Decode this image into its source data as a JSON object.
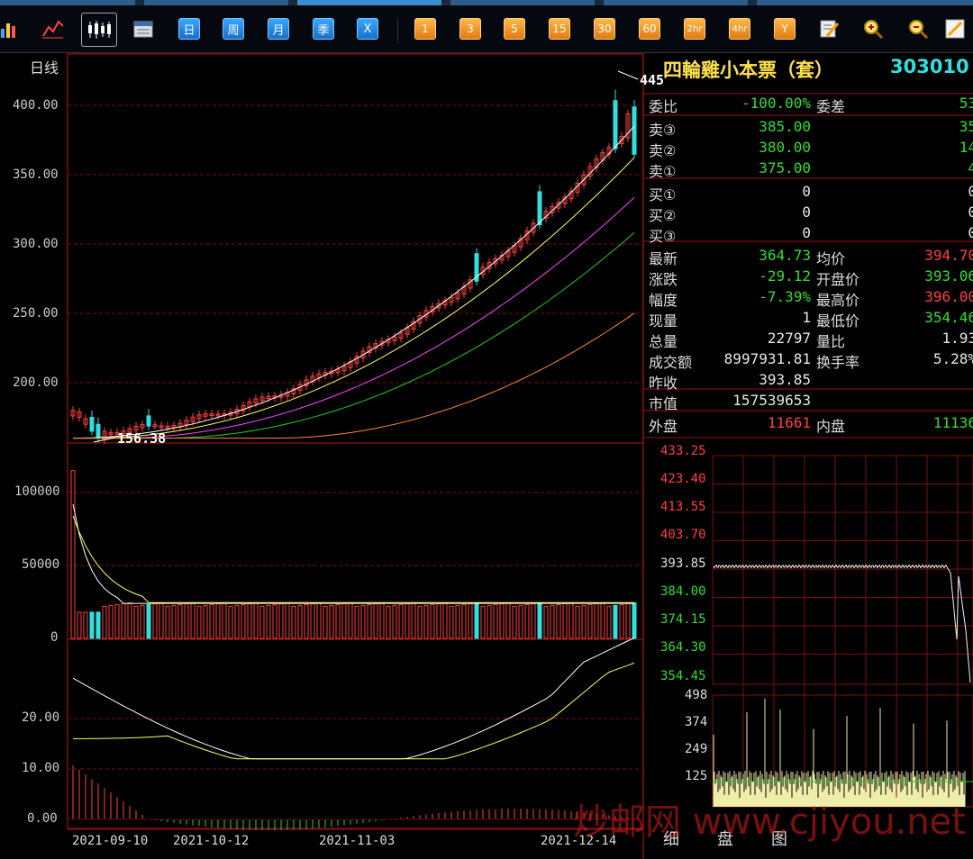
{
  "toolbar": {
    "period_buttons": [
      "日",
      "周",
      "月",
      "季",
      "X"
    ],
    "minute_buttons": [
      "1",
      "3",
      "5",
      "15",
      "30",
      "60",
      "2hr",
      "4hr",
      "Y"
    ],
    "icons": [
      "bar-chart-icon",
      "line-chart-icon",
      "candlestick-icon",
      "calendar-icon",
      "edit-icon",
      "zoom-in-icon",
      "zoom-out-icon",
      "draw-pencil-icon"
    ]
  },
  "main_chart": {
    "period_label": "日线",
    "y_ticks": [
      "400.00",
      "350.00",
      "300.00",
      "250.00",
      "200.00"
    ],
    "high_marker": "445",
    "low_marker": "156.38"
  },
  "volume_chart": {
    "y_ticks": [
      "100000",
      "50000",
      "0"
    ]
  },
  "indicator_chart": {
    "y_ticks": [
      "20.00",
      "10.00",
      "0.00"
    ]
  },
  "x_axis_dates": [
    "2021-09-10",
    "2021-10-12",
    "2021-11-03",
    "2021-12-14"
  ],
  "quote": {
    "title": "四輪雞小本票（套）",
    "code": "303010",
    "weibi_label": "委比",
    "weibi_value": "-100.00%",
    "weicha_label": "委差",
    "weicha_value": "53",
    "asks": [
      {
        "label": "卖③",
        "price": "385.00",
        "vol": "35"
      },
      {
        "label": "卖②",
        "price": "380.00",
        "vol": "14"
      },
      {
        "label": "卖①",
        "price": "375.00",
        "vol": "4"
      }
    ],
    "bids": [
      {
        "label": "买①",
        "price": "0",
        "vol": "0"
      },
      {
        "label": "买②",
        "price": "0",
        "vol": "0"
      },
      {
        "label": "买③",
        "price": "0",
        "vol": "0"
      }
    ],
    "stats_left": [
      {
        "label": "最新",
        "value": "364.73"
      },
      {
        "label": "涨跌",
        "value": "-29.12"
      },
      {
        "label": "幅度",
        "value": "-7.39%"
      },
      {
        "label": "现量",
        "value": "1"
      },
      {
        "label": "总量",
        "value": "22797"
      },
      {
        "label": "成交额",
        "value": "8997931.81"
      },
      {
        "label": "昨收",
        "value": "393.85"
      },
      {
        "label": "市值",
        "value": "157539653"
      }
    ],
    "stats_right": [
      {
        "label": "均价",
        "value": "394.70"
      },
      {
        "label": "开盘价",
        "value": "393.06"
      },
      {
        "label": "最高价",
        "value": "396.00"
      },
      {
        "label": "最低价",
        "value": "354.46"
      },
      {
        "label": "量比",
        "value": "1.93"
      },
      {
        "label": "换手率",
        "value": "5.28%"
      }
    ],
    "waipan_label": "外盘",
    "waipan_value": "11661",
    "neipan_label": "内盘",
    "neipan_value": "11136"
  },
  "intraday": {
    "price_ticks": [
      "433.25",
      "423.40",
      "413.55",
      "403.70",
      "393.85",
      "384.00",
      "374.15",
      "364.30",
      "354.45"
    ],
    "volume_ticks": [
      "498",
      "374",
      "249",
      "125"
    ]
  },
  "bottom_tabs": [
    "细",
    "盘",
    "图"
  ],
  "watermark": "炒邮网 www.cjiyou.net",
  "colors": {
    "up": "#ff4040",
    "down": "#30e0e0",
    "grid": "#7a1010",
    "ma5": "#ffffff",
    "ma10": "#ffff66",
    "ma20": "#ff44ff",
    "ma30": "#22cc22",
    "ma60": "#ff8833"
  }
}
